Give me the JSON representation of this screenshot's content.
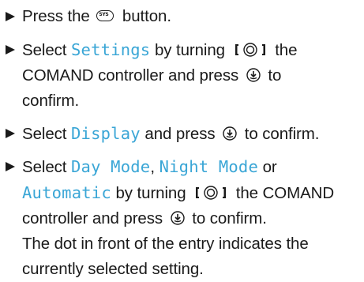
{
  "steps": [
    {
      "lines": [
        {
          "before": "Press the",
          "icon": "sys-button-icon",
          "icon_text": "SYS",
          "after": "button."
        }
      ]
    },
    {
      "lines": [
        {
          "before": "Select",
          "menu": "Settings",
          "mid": "by turning",
          "icon": "turn-controller-icon",
          "after": "the"
        },
        {
          "text": "COMAND controller and press",
          "icon": "press-controller-icon",
          "after": "to"
        },
        {
          "text": "confirm."
        }
      ]
    },
    {
      "lines": [
        {
          "before": "Select",
          "menu": "Display",
          "mid": "and press",
          "icon": "press-controller-icon",
          "after": "to confirm."
        }
      ]
    },
    {
      "lines": [
        {
          "before": "Select",
          "menu1": "Day Mode",
          "sep1": ",",
          "menu2": "Night Mode",
          "sep2": "or"
        },
        {
          "menu": "Automatic",
          "mid": "by turning",
          "icon": "turn-controller-icon",
          "after": "the COMAND"
        },
        {
          "text": "controller and press",
          "icon": "press-controller-icon",
          "after": "to confirm."
        },
        {
          "text": "The dot in front of the entry indicates the"
        },
        {
          "text": "currently selected setting."
        }
      ]
    }
  ],
  "colors": {
    "menu_text": "#3aa6d6",
    "body_text": "#1a1a1a",
    "background": "#ffffff"
  }
}
